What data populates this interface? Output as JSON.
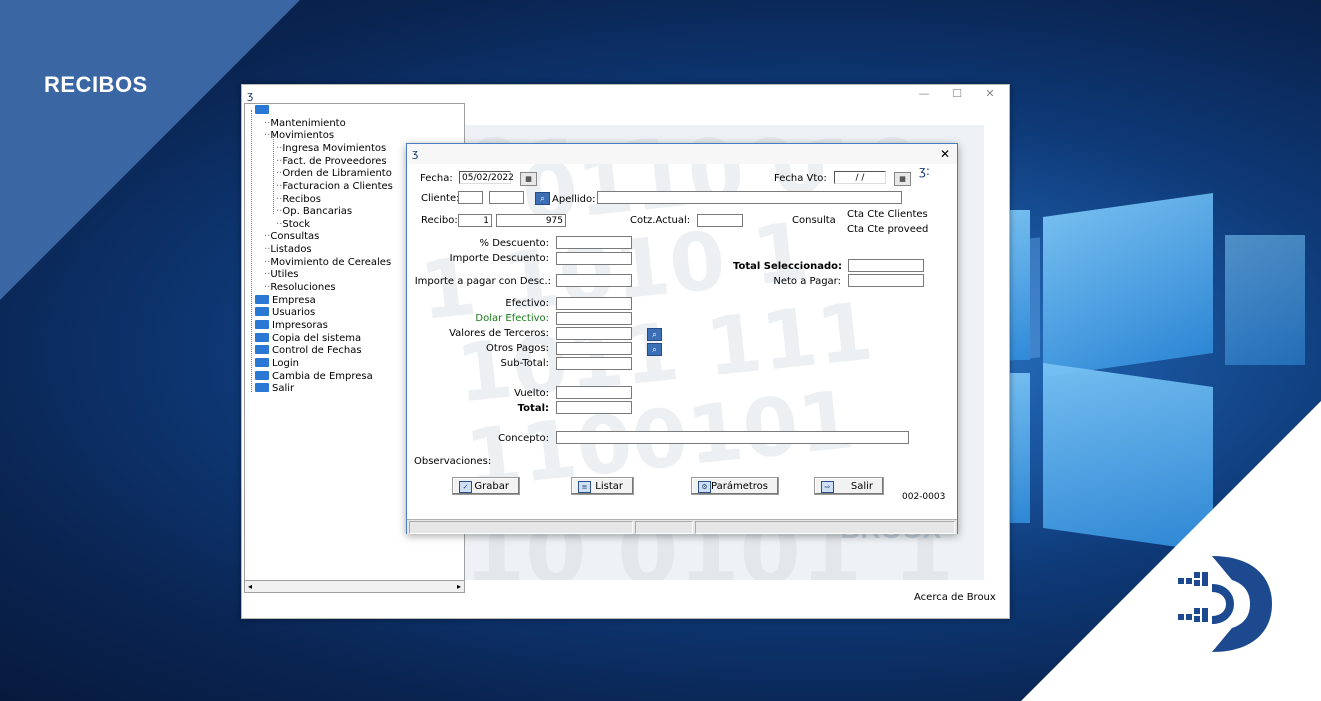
{
  "banner": {
    "title": "RECIBOS"
  },
  "main_window": {
    "icon": "broux-app-icon",
    "controls": {
      "minimize": "—",
      "maximize": "☐",
      "close": "✕"
    },
    "tree": {
      "root": "",
      "items": [
        {
          "label": "Mantenimiento",
          "level": 1,
          "folder": false
        },
        {
          "label": "Movimientos",
          "level": 1,
          "folder": false
        },
        {
          "label": "Ingresa Movimientos",
          "level": 2,
          "folder": false
        },
        {
          "label": "Fact. de Proveedores",
          "level": 2,
          "folder": false
        },
        {
          "label": "Orden de Libramiento",
          "level": 2,
          "folder": false
        },
        {
          "label": "Facturacion a Clientes",
          "level": 2,
          "folder": false
        },
        {
          "label": "Recibos",
          "level": 2,
          "folder": false
        },
        {
          "label": "Op. Bancarias",
          "level": 2,
          "folder": false
        },
        {
          "label": "Stock",
          "level": 2,
          "folder": false
        },
        {
          "label": "Consultas",
          "level": 1,
          "folder": false
        },
        {
          "label": "Listados",
          "level": 1,
          "folder": false
        },
        {
          "label": "Movimiento de Cereales",
          "level": 1,
          "folder": false
        },
        {
          "label": "Utiles",
          "level": 1,
          "folder": false
        },
        {
          "label": "Resoluciones",
          "level": 1,
          "folder": false
        },
        {
          "label": "Empresa",
          "level": 1,
          "folder": true
        },
        {
          "label": "Usuarios",
          "level": 1,
          "folder": true
        },
        {
          "label": "Impresoras",
          "level": 1,
          "folder": true
        },
        {
          "label": "Copia del sistema",
          "level": 1,
          "folder": true
        },
        {
          "label": "Control de Fechas",
          "level": 1,
          "folder": true
        },
        {
          "label": "Login",
          "level": 1,
          "folder": true
        },
        {
          "label": "Cambia de Empresa",
          "level": 1,
          "folder": true
        },
        {
          "label": "Salir",
          "level": 1,
          "folder": true
        }
      ]
    },
    "acerca": "Acerca de Broux"
  },
  "dialog": {
    "close": "✕",
    "fecha_label": "Fecha:",
    "fecha_value": "05/02/2022",
    "fecha_vto_label": "Fecha Vto:",
    "fecha_vto_value": "/ /",
    "cliente_label": "Cliente:",
    "apellido_label": "Apellido:",
    "recibo_label": "Recibo:",
    "recibo_serie": "1",
    "recibo_numero": "975",
    "cotz_label": "Cotz.Actual:",
    "consulta_label": "Consulta",
    "cta_clientes": "Cta Cte Clientes",
    "cta_proveed": "Cta Cte proveed",
    "pct_descuento_label": "% Descuento:",
    "importe_descuento_label": "Importe Descuento:",
    "importe_pagar_label": "Importe a pagar con Desc.:",
    "total_seleccionado_label": "Total Seleccionado:",
    "neto_pagar_label": "Neto a Pagar:",
    "efectivo_label": "Efectivo:",
    "dolar_label": "Dolar Efectivo:",
    "valores_terceros_label": "Valores de Terceros:",
    "otros_pagos_label": "Otros Pagos:",
    "subtotal_label": "Sub-Total:",
    "vuelto_label": "Vuelto:",
    "total_label": "Total:",
    "concepto_label": "Concepto:",
    "observaciones_label": "Observaciones:",
    "buttons": {
      "grabar": "Grabar",
      "listar": "Listar",
      "parametros": "Parámetros",
      "salir": "Salir"
    },
    "code": "002-0003",
    "colors": {
      "dolar_label": "#1a7a1a",
      "search_button": "#3b6fb6"
    }
  }
}
